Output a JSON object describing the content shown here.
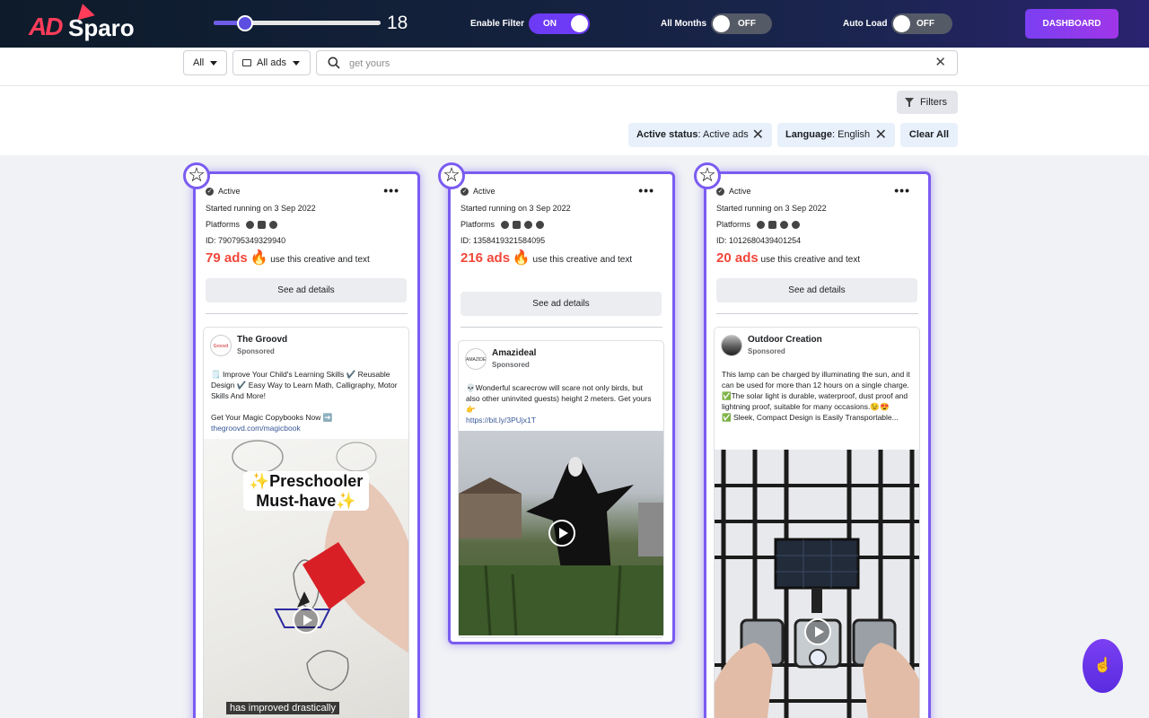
{
  "app": {
    "logo_ad": "AD",
    "logo_name": "Sparo"
  },
  "topbar": {
    "slider_value": "18",
    "slider_fraction": 0.19,
    "enable_filter": {
      "label": "Enable Filter",
      "state": "ON"
    },
    "all_months": {
      "label": "All Months",
      "state": "OFF"
    },
    "auto_load": {
      "label": "Auto Load",
      "state": "OFF"
    },
    "dashboard": "DASHBOARD"
  },
  "search": {
    "country": "All",
    "ad_type": "All ads",
    "placeholder": "get yours",
    "value": ""
  },
  "filters": {
    "button": "Filters",
    "chips": [
      {
        "key": "Active status",
        "value": ": Active ads"
      },
      {
        "key": "Language",
        "value": ": English"
      }
    ],
    "clear_all": "Clear All"
  },
  "cards": [
    {
      "status": "Active",
      "started": "Started running on 3 Sep 2022",
      "platforms_label": "Platforms",
      "id": "ID: 790795349329940",
      "count": "79 ads",
      "count_suffix": "use this creative and text",
      "details": "See ad details",
      "advertiser": "The Groovd",
      "avatar_text": "Groovd",
      "sponsored": "Sponsored",
      "body": "🗒️ Improve Your Child's Learning Skills ✔️ Reusable Design ✔️ Easy Way to Learn Math, Calligraphy, Motor Skills And More!\n\nGet Your Magic Copybooks Now ➡️",
      "link": "thegroovd.com/magicbook",
      "overlay_title": "✨Preschooler Must-have✨",
      "caption": "has improved drastically"
    },
    {
      "status": "Active",
      "started": "Started running on 3 Sep 2022",
      "platforms_label": "Platforms",
      "id": "ID: 1358419321584095",
      "count": "216 ads",
      "count_suffix": "use this creative and text",
      "details": "See ad details",
      "advertiser": "Amazideal",
      "avatar_text": "AMAZIDEAL",
      "sponsored": "Sponsored",
      "body": "💀Wonderful scarecrow will scare not only birds, but also other uninvited guests) height 2 meters. Get yours👉",
      "link": "https://bit.ly/3PUjx1T"
    },
    {
      "status": "Active",
      "started": "Started running on 3 Sep 2022",
      "platforms_label": "Platforms",
      "id": "ID: 1012680439401254",
      "count": "20 ads",
      "count_suffix": "use this creative and text",
      "details": "See ad details",
      "advertiser": "Outdoor Creation",
      "sponsored": "Sponsored",
      "body": "This lamp can be charged by illuminating the sun, and it can be used for more than 12 hours on a single charge.\n✅The solar light is durable, waterproof, dust proof and lightning proof, suitable for many occasions.😉😍\n✅ Sleek, Compact Design is Easily Transportable..."
    }
  ],
  "fab_icon": "☝"
}
